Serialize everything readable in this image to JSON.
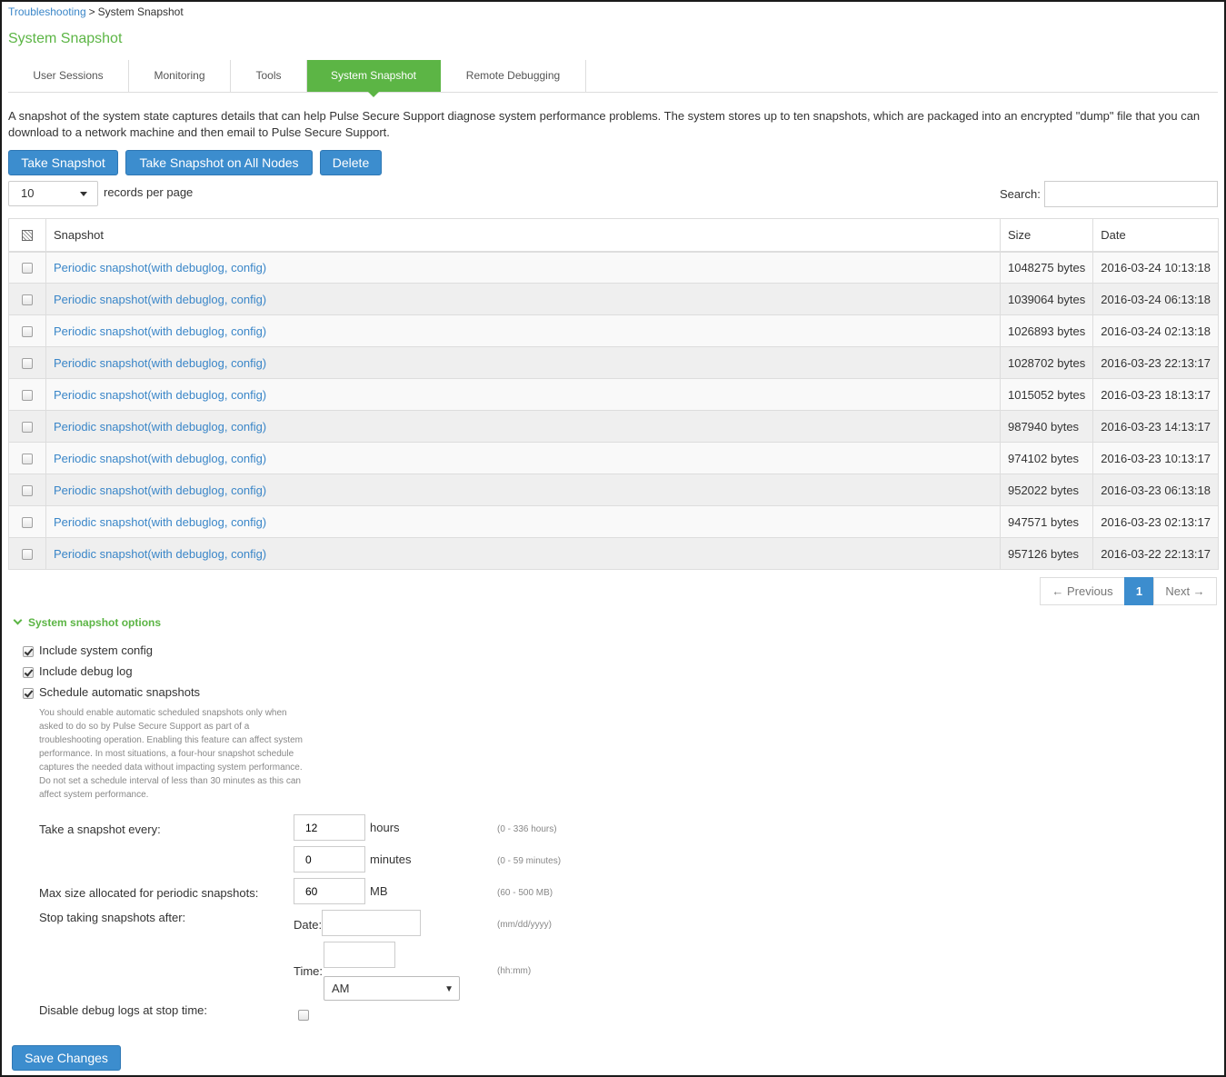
{
  "breadcrumb": {
    "parent": "Troubleshooting",
    "separator": ">",
    "current": "System Snapshot"
  },
  "page_title": "System Snapshot",
  "tabs": [
    {
      "label": "User Sessions"
    },
    {
      "label": "Monitoring"
    },
    {
      "label": "Tools"
    },
    {
      "label": "System Snapshot"
    },
    {
      "label": "Remote Debugging"
    }
  ],
  "active_tab": "System Snapshot",
  "description": "A snapshot of the system state captures details that can help Pulse Secure Support diagnose system performance problems. The system stores up to ten snapshots, which are packaged into an encrypted \"dump\" file that you can download to a network machine and then email to Pulse Secure Support.",
  "actions": {
    "take_snapshot": "Take Snapshot",
    "take_snapshot_all": "Take Snapshot on All Nodes",
    "delete": "Delete"
  },
  "records_per_page": {
    "value": "10",
    "label": "records per page"
  },
  "search": {
    "label": "Search:",
    "value": ""
  },
  "table": {
    "columns": {
      "snapshot": "Snapshot",
      "size": "Size",
      "date": "Date"
    },
    "rows": [
      {
        "snapshot": "Periodic snapshot(with debuglog, config)",
        "size": "1048275 bytes",
        "date": "2016-03-24 10:13:18"
      },
      {
        "snapshot": "Periodic snapshot(with debuglog, config)",
        "size": "1039064 bytes",
        "date": "2016-03-24 06:13:18"
      },
      {
        "snapshot": "Periodic snapshot(with debuglog, config)",
        "size": "1026893 bytes",
        "date": "2016-03-24 02:13:18"
      },
      {
        "snapshot": "Periodic snapshot(with debuglog, config)",
        "size": "1028702 bytes",
        "date": "2016-03-23 22:13:17"
      },
      {
        "snapshot": "Periodic snapshot(with debuglog, config)",
        "size": "1015052 bytes",
        "date": "2016-03-23 18:13:17"
      },
      {
        "snapshot": "Periodic snapshot(with debuglog, config)",
        "size": "987940 bytes",
        "date": "2016-03-23 14:13:17"
      },
      {
        "snapshot": "Periodic snapshot(with debuglog, config)",
        "size": "974102 bytes",
        "date": "2016-03-23 10:13:17"
      },
      {
        "snapshot": "Periodic snapshot(with debuglog, config)",
        "size": "952022 bytes",
        "date": "2016-03-23 06:13:18"
      },
      {
        "snapshot": "Periodic snapshot(with debuglog, config)",
        "size": "947571 bytes",
        "date": "2016-03-23 02:13:17"
      },
      {
        "snapshot": "Periodic snapshot(with debuglog, config)",
        "size": "957126 bytes",
        "date": "2016-03-22 22:13:17"
      }
    ]
  },
  "pagination": {
    "previous": "← Previous",
    "current": "1",
    "next": "Next →"
  },
  "options": {
    "toggle_label": "System snapshot options",
    "include_config": "Include system config",
    "include_debug_log": "Include debug log",
    "schedule_auto": "Schedule automatic snapshots",
    "schedule_help": "You should enable automatic scheduled snapshots only when asked to do so by Pulse Secure Support as part of a troubleshooting operation. Enabling this feature can affect system performance. In most situations, a four-hour snapshot schedule captures the needed data without impacting system performance. Do not set a schedule interval of less than 30 minutes as this can affect system performance.",
    "every_label": "Take a snapshot every:",
    "hours_value": "12",
    "hours_unit": "hours",
    "hours_range": "(0 - 336 hours)",
    "minutes_value": "0",
    "minutes_unit": "minutes",
    "minutes_range": "(0 - 59 minutes)",
    "max_size_label": "Max size allocated for periodic snapshots:",
    "max_size_value": "60",
    "max_size_unit": "MB",
    "max_size_range": "(60 - 500 MB)",
    "stop_label": "Stop taking snapshots after:",
    "date_label": "Date:",
    "date_format": "(mm/dd/yyyy)",
    "time_label": "Time:",
    "time_format": "(hh:mm)",
    "ampm_value": "AM",
    "disable_debug_label": "Disable debug logs at stop time:"
  },
  "save_label": "Save Changes",
  "colors": {
    "accent_green": "#5cb545",
    "button_blue": "#3c8dce",
    "link_blue": "#3a86c8"
  }
}
